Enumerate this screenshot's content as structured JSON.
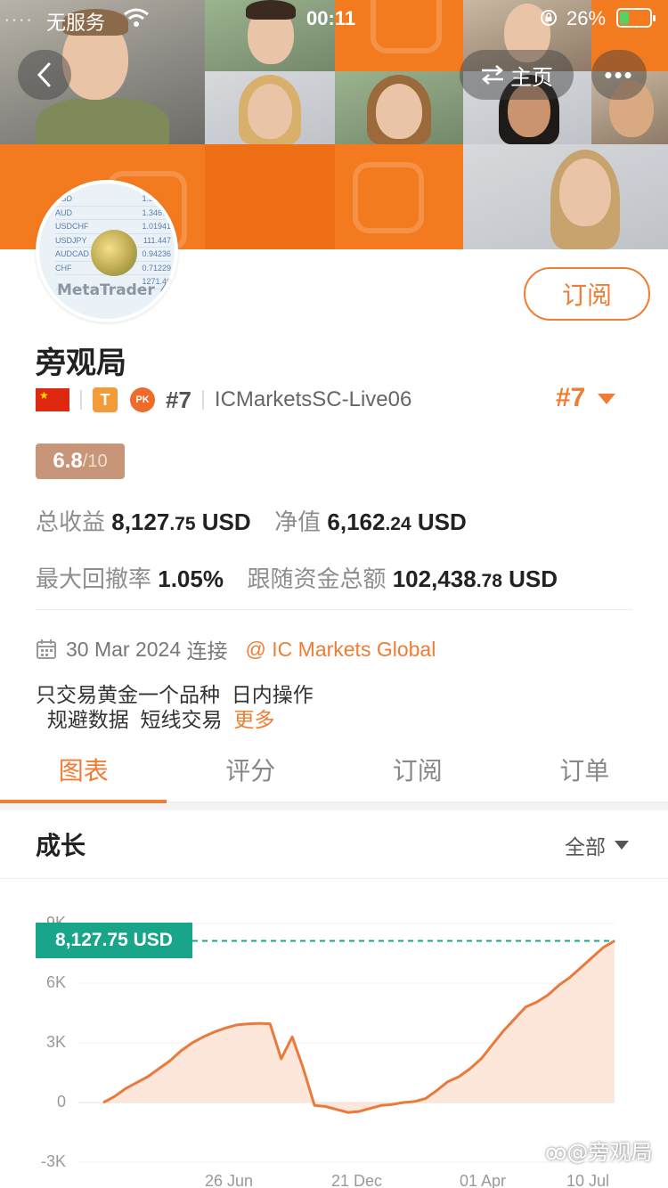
{
  "status_bar": {
    "carrier": "无服务",
    "time": "00:11",
    "battery": "26%"
  },
  "header": {
    "home_label": "主页"
  },
  "profile": {
    "name": "旁观局",
    "subscribe_label": "订阅",
    "rank": "#7",
    "rank_badge": "#7",
    "server": "ICMarketsSC-Live06",
    "t_badge": "T",
    "pk_badge": "PK",
    "score_main": "6.8",
    "score_of": "/10",
    "avatar_logo": "MetaTrader 4",
    "avatar_rows": [
      {
        "sym": "USD",
        "val": "1.30361"
      },
      {
        "sym": "AUD",
        "val": "1.34678"
      },
      {
        "sym": "USDCHF",
        "val": "1.01941"
      },
      {
        "sym": "USDJPY",
        "val": "111.447"
      },
      {
        "sym": "AUDCAD",
        "val": "0.94236"
      },
      {
        "sym": "CHF",
        "val": "0.71229"
      },
      {
        "sym": "",
        "val": "1271.40"
      }
    ]
  },
  "stats": {
    "total_profit_label": "总收益",
    "total_profit_int": "8,127",
    "total_profit_dec": ".75",
    "total_profit_cur": "USD",
    "equity_label": "净值",
    "equity_int": "6,162",
    "equity_dec": ".24",
    "equity_cur": "USD",
    "max_drawdown_label": "最大回撤率",
    "max_drawdown_value": "1.05%",
    "follow_funds_label": "跟随资金总额",
    "follow_funds_int": "102,438",
    "follow_funds_dec": ".78",
    "follow_funds_cur": "USD"
  },
  "connection": {
    "date": "30 Mar 2024",
    "connect_label": "连接",
    "broker": "@ IC Markets Global"
  },
  "description": {
    "text": "只交易黄金一个品种  日内操作\n  规避数据  短线交易  ",
    "more_label": "更多"
  },
  "tabs": [
    {
      "label": "图表",
      "active": true
    },
    {
      "label": "评分",
      "active": false
    },
    {
      "label": "订阅",
      "active": false
    },
    {
      "label": "订单",
      "active": false
    }
  ],
  "growth": {
    "title": "成长",
    "range_label": "全部"
  },
  "chart_data": {
    "type": "area",
    "current_value_label": "8,127.75 USD",
    "y_ticks": [
      "9K",
      "6K",
      "3K",
      "0",
      "-3K"
    ],
    "y_tick_values": [
      9000,
      6000,
      3000,
      0,
      -3000
    ],
    "x_ticks": [
      "26 Jun",
      "21 Dec",
      "01 Apr",
      "10 Jul"
    ],
    "ylim": [
      -3000,
      9000
    ],
    "series": [
      {
        "values": [
          0,
          300,
          700,
          1000,
          1300,
          1700,
          2100,
          2600,
          3000,
          3300,
          3550,
          3750,
          3900,
          3950,
          3980,
          3960,
          2200,
          3300,
          1700,
          -150,
          -200,
          -350,
          -500,
          -450,
          -300,
          -150,
          -100,
          0,
          50,
          200,
          600,
          1050,
          1300,
          1700,
          2200,
          2900,
          3600,
          4200,
          4800,
          5050,
          5400,
          5900,
          6300,
          6800,
          7300,
          7800,
          8128
        ],
        "color": "#ea7a3c"
      }
    ],
    "colors": {
      "line": "#ea7a3c",
      "fill": "#fde3d3",
      "target_line": "#18a589"
    },
    "grid": true
  },
  "watermark": "@旁观局",
  "colors": {
    "accent": "#ef7d33",
    "banner": "#f47a1f",
    "score_bg": "#c79678",
    "value_tag": "#18a589"
  }
}
